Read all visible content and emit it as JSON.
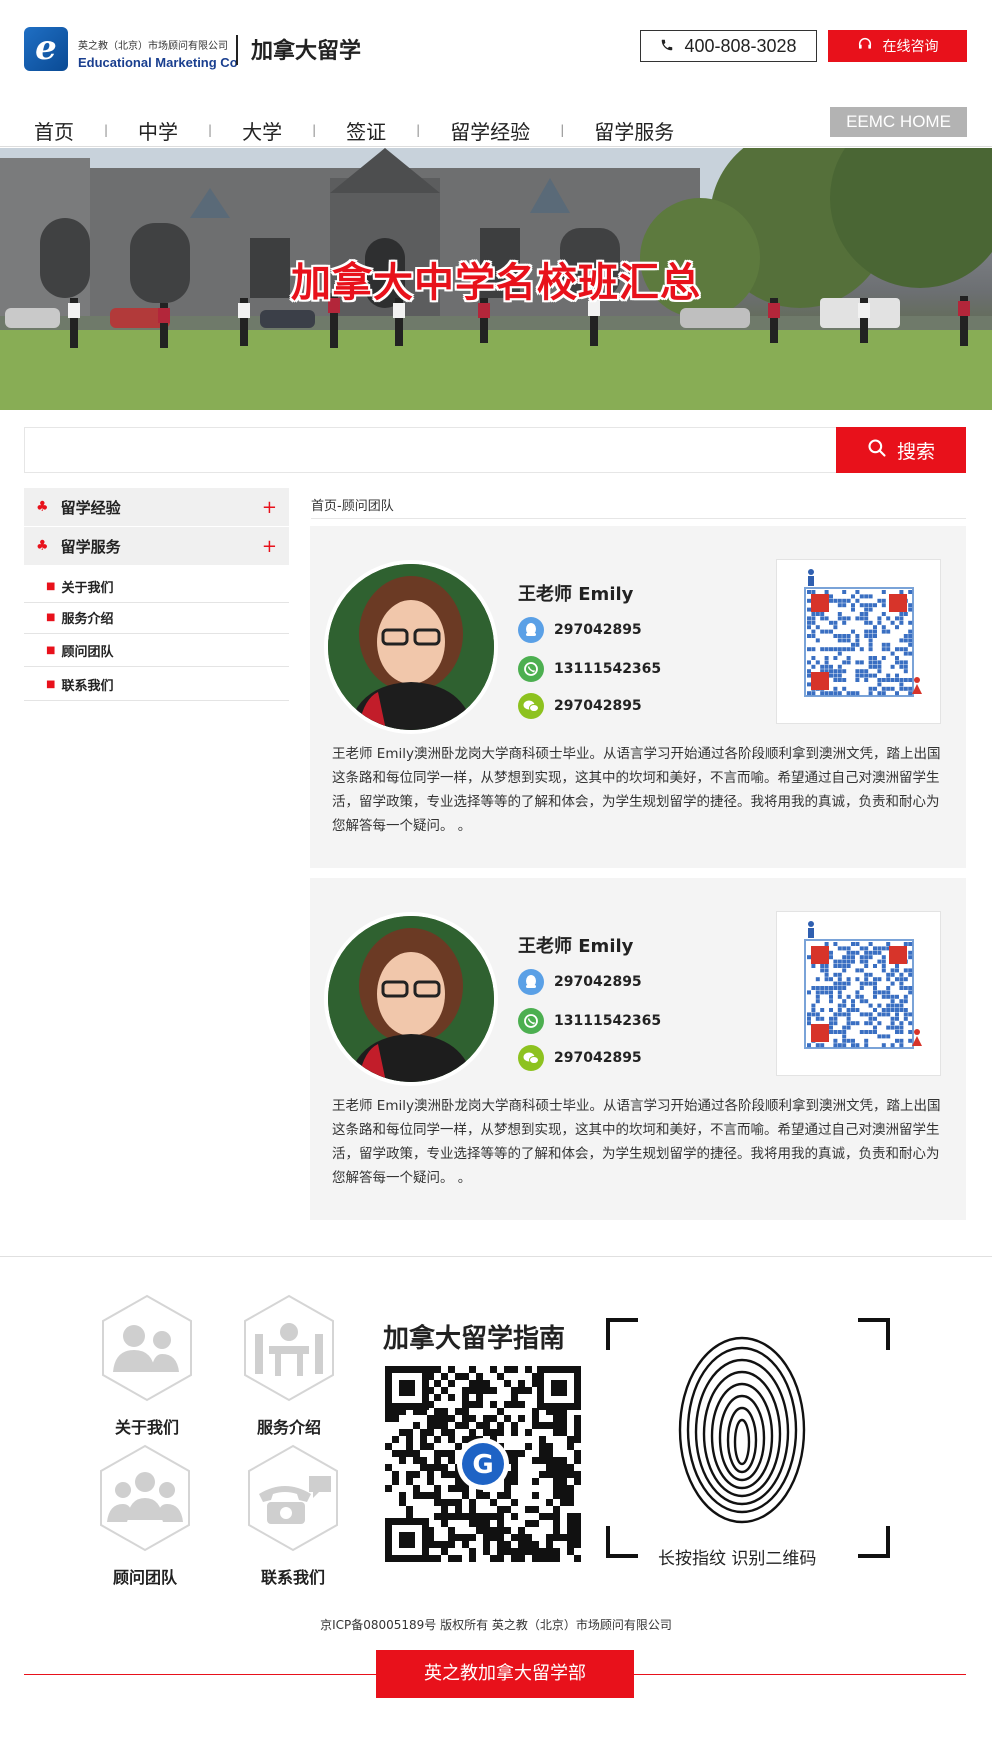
{
  "header": {
    "logo_letter": "e",
    "logo_company_cn": "英之教（北京）市场顾问有限公司",
    "logo_company_en": "Educational Marketing Co",
    "site_title": "加拿大留学",
    "phone": "400-808-3028",
    "consult_label": "在线咨询"
  },
  "nav": {
    "items": [
      "首页",
      "中学",
      "大学",
      "签证",
      "留学经验",
      "留学服务"
    ],
    "active_index": 0,
    "home_label": "EEMC HOME"
  },
  "banner": {
    "title": "加拿大中学名校班汇总"
  },
  "search": {
    "placeholder": "",
    "button_label": "搜索"
  },
  "sidebar": {
    "sections": [
      {
        "label": "留学经验",
        "toggle": "+"
      },
      {
        "label": "留学服务",
        "toggle": "+"
      }
    ],
    "links": [
      "关于我们",
      "服务介绍",
      "顾问团队",
      "联系我们"
    ]
  },
  "breadcrumb": "首页-顾问团队",
  "advisors": [
    {
      "name": "王老师 Emily",
      "qq": "297042895",
      "whatsapp": "13111542365",
      "wechat": "297042895",
      "bio": "王老师 Emily澳洲卧龙岗大学商科硕士毕业。从语言学习开始通过各阶段顺利拿到澳洲文凭，踏上出国这条路和每位同学一样，从梦想到实现，这其中的坎坷和美好，不言而喻。希望通过自己对澳洲留学生活，留学政策，专业选择等等的了解和体会，为学生规划留学的捷径。我将用我的真诚，负责和耐心为您解答每一个疑问。 。"
    },
    {
      "name": "王老师 Emily",
      "qq": "297042895",
      "whatsapp": "13111542365",
      "wechat": "297042895",
      "bio": "王老师 Emily澳洲卧龙岗大学商科硕士毕业。从语言学习开始通过各阶段顺利拿到澳洲文凭，踏上出国这条路和每位同学一样，从梦想到实现，这其中的坎坷和美好，不言而喻。希望通过自己对澳洲留学生活，留学政策，专业选择等等的了解和体会，为学生规划留学的捷径。我将用我的真诚，负责和耐心为您解答每一个疑问。 。"
    }
  ],
  "footer": {
    "links": [
      "关于我们",
      "服务介绍",
      "顾问团队",
      "联系我们"
    ],
    "guide_title": "加拿大留学指南",
    "fingerprint_text": "长按指纹 识别二维码",
    "copyright": "京ICP备08005189号 版权所有 英之教（北京）市场顾问有限公司",
    "badge": "英之教加拿大留学部"
  },
  "colors": {
    "accent": "#e8111b",
    "qq": "#5aa0e6",
    "whatsapp": "#4caf50",
    "wechat": "#8dc21f"
  }
}
